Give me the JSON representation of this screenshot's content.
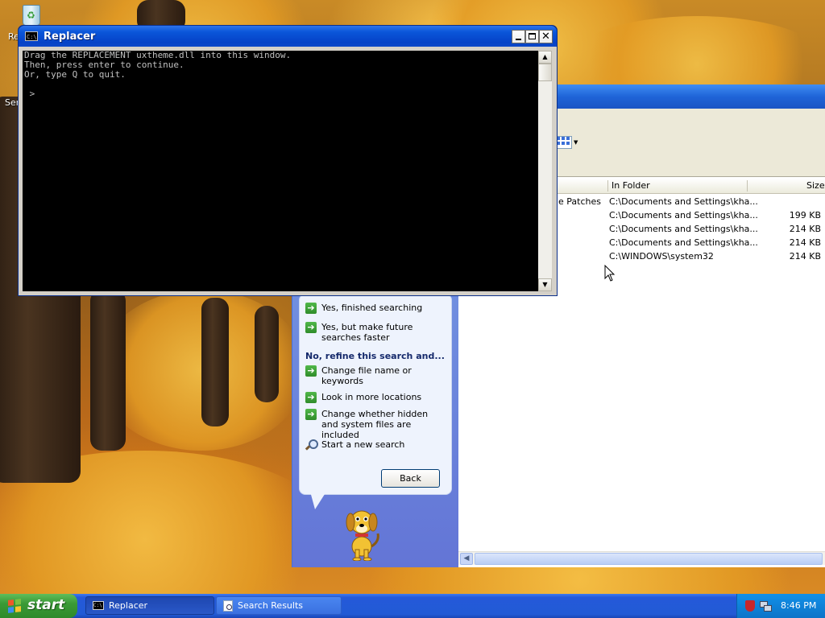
{
  "desktop": {
    "icon_labels": [
      "Re",
      "Ser"
    ]
  },
  "console": {
    "title": "Replacer",
    "lines": [
      "Drag the REPLACEMENT uxtheme.dll into this window.",
      "Then, press enter to continue.",
      "Or, type Q to quit.",
      "",
      " >"
    ],
    "icon": "cmd-icon"
  },
  "search_window": {
    "columns": {
      "in_folder": "In Folder",
      "size": "Size"
    },
    "rows": [
      {
        "name_fragment": "e Patches",
        "folder": "C:\\Documents and Settings\\kha...",
        "size": ""
      },
      {
        "name_fragment": "",
        "folder": "C:\\Documents and Settings\\kha...",
        "size": "199 KB"
      },
      {
        "name_fragment": "",
        "folder": "C:\\Documents and Settings\\kha...",
        "size": "214 KB"
      },
      {
        "name_fragment": "",
        "folder": "C:\\Documents and Settings\\kha...",
        "size": "214 KB"
      },
      {
        "name_fragment": "",
        "folder": "C:\\WINDOWS\\system32",
        "size": "214 KB"
      }
    ],
    "companion": {
      "options_top": [
        "Yes, finished searching",
        "Yes, but make future searches faster"
      ],
      "refine_heading": "No, refine this search and...",
      "options_refine": [
        "Change file name or keywords",
        "Look in more locations",
        "Change whether hidden and system files are included"
      ],
      "new_search": "Start a new search",
      "back_label": "Back"
    }
  },
  "taskbar": {
    "start_label": "start",
    "tasks": [
      {
        "label": "Replacer",
        "active": true
      },
      {
        "label": "Search Results",
        "active": false
      }
    ],
    "clock": "8:46 PM"
  }
}
